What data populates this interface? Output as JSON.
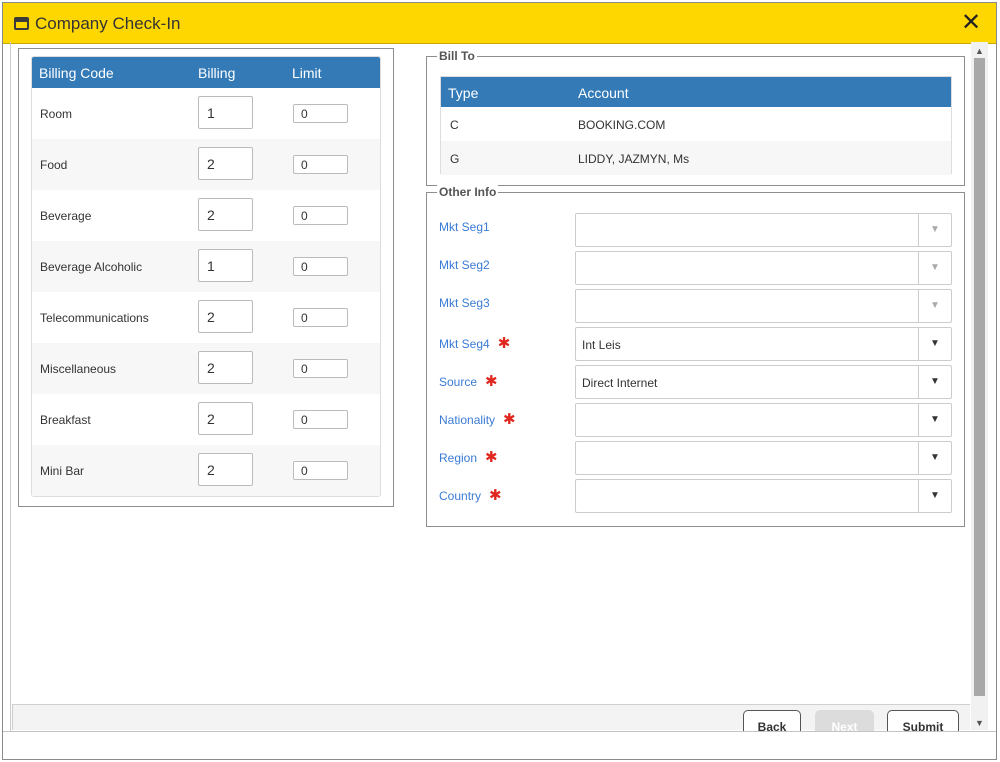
{
  "window": {
    "title": "Company Check-In",
    "close": "✕"
  },
  "billing": {
    "headers": {
      "code": "Billing Code",
      "billing": "Billing",
      "limit": "Limit"
    },
    "rows": [
      {
        "code": "Room",
        "billing": "1",
        "limit": "0"
      },
      {
        "code": "Food",
        "billing": "2",
        "limit": "0"
      },
      {
        "code": "Beverage",
        "billing": "2",
        "limit": "0"
      },
      {
        "code": "Beverage Alcoholic",
        "billing": "1",
        "limit": "0"
      },
      {
        "code": "Telecommunications",
        "billing": "2",
        "limit": "0"
      },
      {
        "code": "Miscellaneous",
        "billing": "2",
        "limit": "0"
      },
      {
        "code": "Breakfast",
        "billing": "2",
        "limit": "0"
      },
      {
        "code": "Mini Bar",
        "billing": "2",
        "limit": "0"
      }
    ]
  },
  "bill_to": {
    "legend": "Bill To",
    "headers": {
      "type": "Type",
      "account": "Account"
    },
    "rows": [
      {
        "type": "C",
        "account": "BOOKING.COM"
      },
      {
        "type": "G",
        "account": "LIDDY, JAZMYN, Ms"
      }
    ]
  },
  "other_info": {
    "legend": "Other Info",
    "fields": [
      {
        "label": "Mkt Seg1",
        "value": "",
        "required": false,
        "disabled": true
      },
      {
        "label": "Mkt Seg2",
        "value": "",
        "required": false,
        "disabled": true
      },
      {
        "label": "Mkt Seg3",
        "value": "",
        "required": false,
        "disabled": true
      },
      {
        "label": "Mkt Seg4",
        "value": "Int Leis",
        "required": true,
        "disabled": false
      },
      {
        "label": "Source",
        "value": "Direct Internet",
        "required": true,
        "disabled": false
      },
      {
        "label": "Nationality",
        "value": "",
        "required": true,
        "disabled": false
      },
      {
        "label": "Region",
        "value": "",
        "required": true,
        "disabled": false
      },
      {
        "label": "Country",
        "value": "",
        "required": true,
        "disabled": false
      }
    ],
    "required_mark": "✱",
    "arrow": "▼"
  },
  "footer": {
    "back": "Back",
    "next": "Next",
    "submit": "Submit"
  },
  "scrollbar": {
    "up": "▲",
    "down": "▼"
  }
}
